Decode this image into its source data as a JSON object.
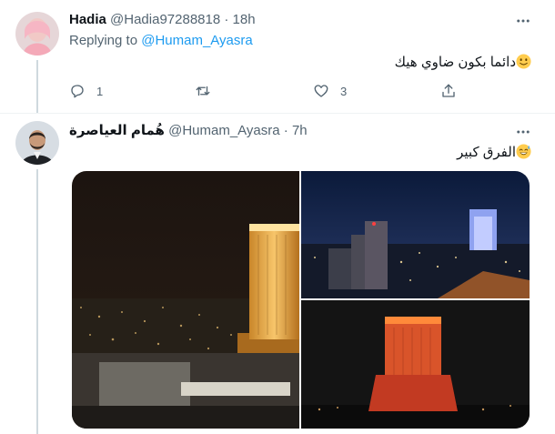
{
  "tweet1": {
    "name": "Hadia",
    "handle": "@Hadia97288818",
    "time": "18h",
    "replying_label": "Replying to",
    "replying_to": "@Humam_Ayasra",
    "text": "دائما بكون ضاوي هيك",
    "emoji": "slightly-smiling-face",
    "reply_count": "1",
    "retweet_count": "",
    "like_count": "3"
  },
  "tweet2": {
    "name": "هُمام العياصرة",
    "handle": "@Humam_Ayasra",
    "time": "7h",
    "text": "الفرق كبير",
    "emoji": "grinning-sweat-face",
    "photos": [
      "city-night-orange-tower",
      "city-night-blue-tower",
      "red-lit-tower-night"
    ]
  },
  "colors": {
    "link": "#1d9bf0",
    "secondary": "#536471",
    "thread_line": "#cfd9de"
  }
}
